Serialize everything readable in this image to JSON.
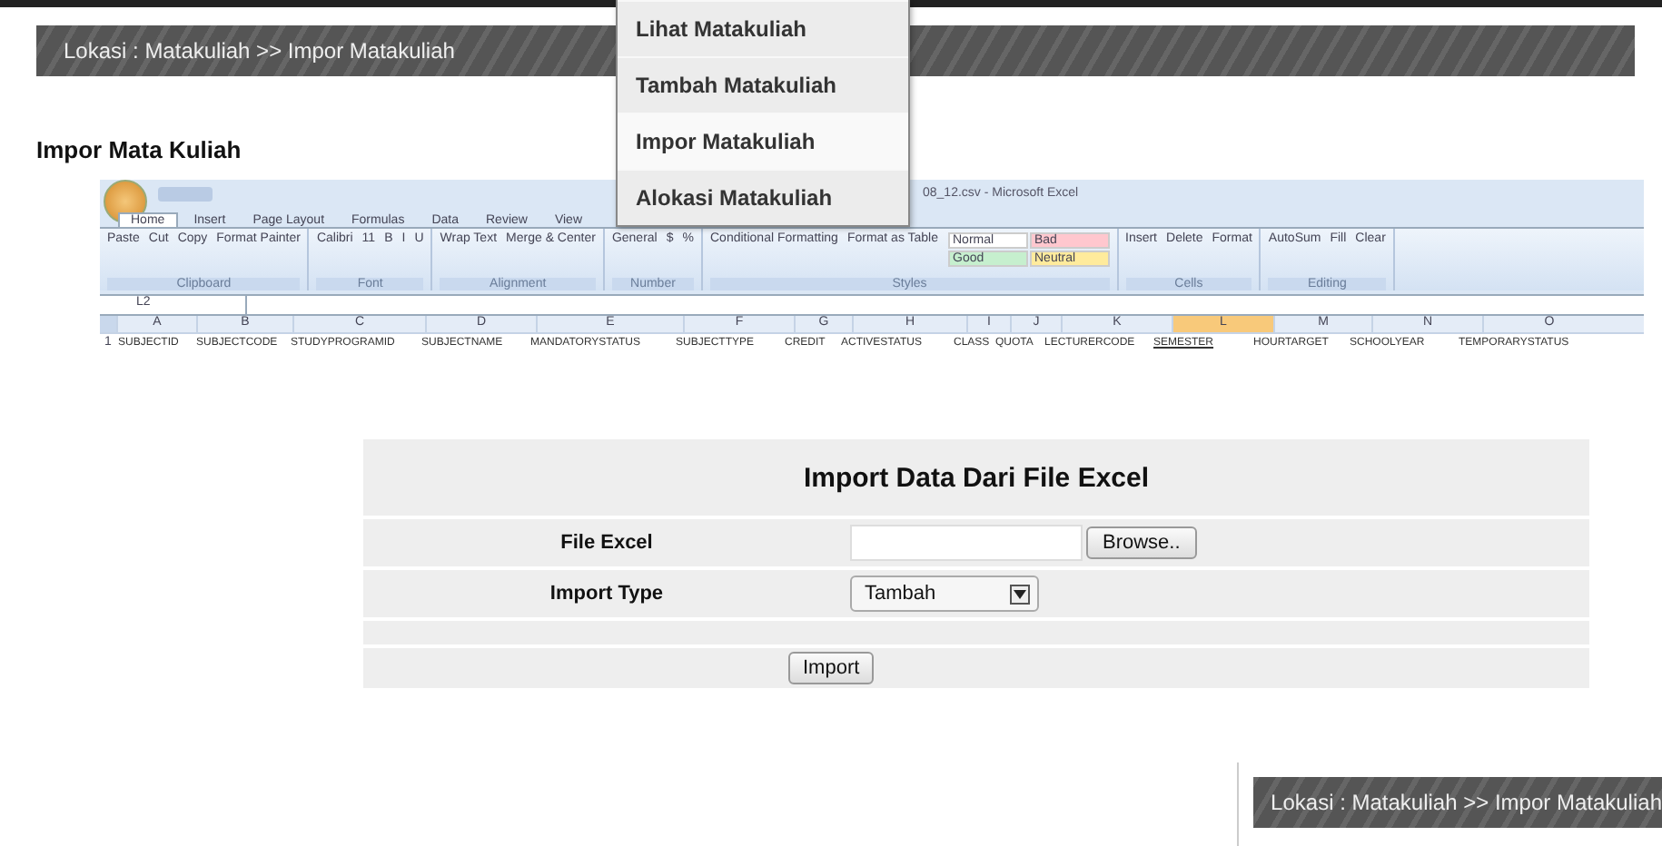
{
  "breadcrumb": "Lokasi : Matakuliah >> Impor Matakuliah",
  "menu": [
    {
      "label": "Lihat Matakuliah",
      "selected": false
    },
    {
      "label": "Tambah Matakuliah",
      "selected": false
    },
    {
      "label": "Impor Matakuliah",
      "selected": true
    },
    {
      "label": "Alokasi Matakuliah",
      "selected": false
    }
  ],
  "heading": "Impor Mata Kuliah",
  "excel": {
    "title": "08_12.csv - Microsoft Excel",
    "tabs": [
      {
        "label": "Home",
        "selected": true
      },
      {
        "label": "Insert",
        "selected": false
      },
      {
        "label": "Page Layout",
        "selected": false
      },
      {
        "label": "Formulas",
        "selected": false
      },
      {
        "label": "Data",
        "selected": false
      },
      {
        "label": "Review",
        "selected": false
      },
      {
        "label": "View",
        "selected": false
      }
    ],
    "groups": [
      {
        "name": "Clipboard",
        "items": [
          "Paste",
          "Cut",
          "Copy",
          "Format Painter"
        ]
      },
      {
        "name": "Font",
        "items": [
          "Calibri",
          "11",
          "B",
          "I",
          "U"
        ]
      },
      {
        "name": "Alignment",
        "items": [
          "Wrap Text",
          "Merge & Center"
        ]
      },
      {
        "name": "Number",
        "items": [
          "General",
          "$",
          "%"
        ]
      },
      {
        "name": "Styles",
        "items": [
          "Conditional Formatting",
          "Format as Table"
        ],
        "styles": [
          {
            "label": "Normal",
            "color": "#ffffff"
          },
          {
            "label": "Bad",
            "color": "#ffc7ce"
          },
          {
            "label": "Good",
            "color": "#c6efce"
          },
          {
            "label": "Neutral",
            "color": "#ffeb9c"
          }
        ]
      },
      {
        "name": "Cells",
        "items": [
          "Insert",
          "Delete",
          "Format"
        ]
      },
      {
        "name": "Editing",
        "items": [
          "AutoSum",
          "Fill",
          "Clear"
        ]
      }
    ],
    "name_box": "L2",
    "row_number": "1",
    "columns": [
      {
        "letter": "A",
        "header": "SUBJECTID",
        "selected": false
      },
      {
        "letter": "B",
        "header": "SUBJECTCODE",
        "selected": false
      },
      {
        "letter": "C",
        "header": "STUDYPROGRAMID",
        "selected": false
      },
      {
        "letter": "D",
        "header": "SUBJECTNAME",
        "selected": false
      },
      {
        "letter": "E",
        "header": "MANDATORYSTATUS",
        "selected": false
      },
      {
        "letter": "F",
        "header": "SUBJECTTYPE",
        "selected": false
      },
      {
        "letter": "G",
        "header": "CREDIT",
        "selected": false
      },
      {
        "letter": "H",
        "header": "ACTIVESTATUS",
        "selected": false
      },
      {
        "letter": "I",
        "header": "CLASS",
        "selected": false
      },
      {
        "letter": "J",
        "header": "QUOTA",
        "selected": false
      },
      {
        "letter": "K",
        "header": "LECTURERCODE",
        "selected": false
      },
      {
        "letter": "L",
        "header": "SEMESTER",
        "selected": true
      },
      {
        "letter": "M",
        "header": "HOURTARGET",
        "selected": false
      },
      {
        "letter": "N",
        "header": "SCHOOLYEAR",
        "selected": false
      },
      {
        "letter": "O",
        "header": "TEMPORARYSTATUS",
        "selected": false
      }
    ]
  },
  "form": {
    "title": "Import Data Dari File Excel",
    "file_label": "File Excel",
    "browse_button": "Browse..",
    "type_label": "Import Type",
    "type_value": "Tambah",
    "submit": "Import"
  },
  "footer_breadcrumb": "Lokasi : Matakuliah >> Impor Matakuliah"
}
